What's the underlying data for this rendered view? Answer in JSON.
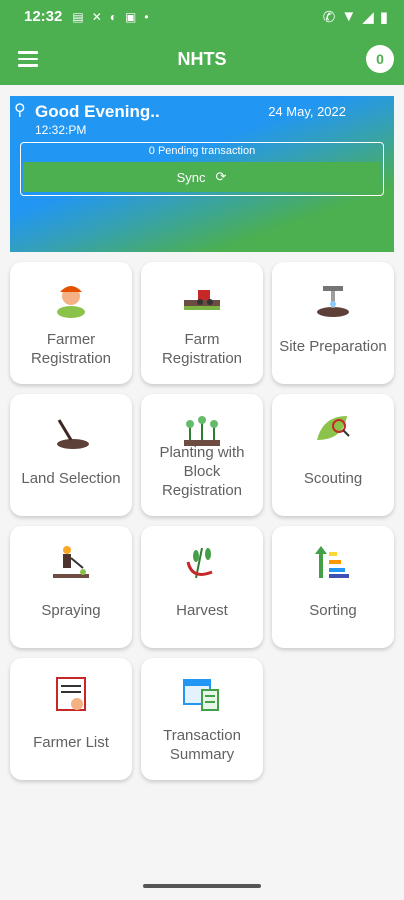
{
  "status_bar": {
    "time": "12:32",
    "dot": "•"
  },
  "app_bar": {
    "menu_icon": "hamburger-menu-icon",
    "title": "NHTS",
    "badge": "0"
  },
  "banner": {
    "greeting": "Good Evening..",
    "date": "24 May, 2022",
    "time": "12:32:PM",
    "pending": "0 Pending transaction",
    "sync_label": "Sync"
  },
  "tiles": [
    {
      "label": "Farmer Registration",
      "icon": "farmer-icon"
    },
    {
      "label": "Farm Registration",
      "icon": "tractor-field-icon"
    },
    {
      "label": "Site Preparation",
      "icon": "pickaxe-soil-icon"
    },
    {
      "label": "Land Selection",
      "icon": "shovel-dirt-icon"
    },
    {
      "label": "Planting with Block Registration",
      "icon": "seedlings-icon"
    },
    {
      "label": "Scouting",
      "icon": "leaf-magnifier-icon"
    },
    {
      "label": "Spraying",
      "icon": "sprayer-man-icon"
    },
    {
      "label": "Harvest",
      "icon": "sickle-wheat-icon"
    },
    {
      "label": "Sorting",
      "icon": "sort-bars-icon"
    },
    {
      "label": "Farmer List",
      "icon": "farmer-list-icon"
    },
    {
      "label": "Transaction Summary",
      "icon": "calendar-summary-icon"
    }
  ],
  "colors": {
    "primary": "#4caf50",
    "banner_blue": "#2196f3",
    "text_gray": "#616161"
  }
}
